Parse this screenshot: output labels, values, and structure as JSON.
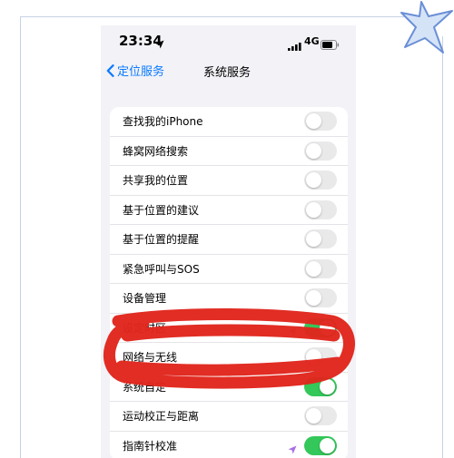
{
  "status_bar": {
    "time": "23:34",
    "network": "4G"
  },
  "nav": {
    "back_label": "定位服务",
    "title": "系统服务"
  },
  "settings": [
    {
      "label": "查找我的iPhone",
      "on": false,
      "location_arrow": false
    },
    {
      "label": "蜂窝网络搜索",
      "on": false,
      "location_arrow": false
    },
    {
      "label": "共享我的位置",
      "on": false,
      "location_arrow": false
    },
    {
      "label": "基于位置的建议",
      "on": false,
      "location_arrow": false
    },
    {
      "label": "基于位置的提醒",
      "on": false,
      "location_arrow": false
    },
    {
      "label": "紧急呼叫与SOS",
      "on": false,
      "location_arrow": false
    },
    {
      "label": "设备管理",
      "on": false,
      "location_arrow": false
    },
    {
      "label": "设定时区",
      "on": true,
      "location_arrow": true
    },
    {
      "label": "网络与无线",
      "on": false,
      "location_arrow": false
    },
    {
      "label": "系统自定",
      "on": true,
      "location_arrow": false
    },
    {
      "label": "运动校正与距离",
      "on": false,
      "location_arrow": false
    },
    {
      "label": "指南针校准",
      "on": true,
      "location_arrow": true
    }
  ],
  "colors": {
    "accent_blue": "#0a7aff",
    "toggle_on": "#34c759",
    "annotation_red": "#e0261d",
    "location_purple": "#a86ee6"
  },
  "icons": {
    "back": "chevron-left-icon",
    "location": "location-arrow-icon",
    "signal": "signal-bars-icon",
    "battery": "battery-icon",
    "decoration": "star-icon"
  }
}
